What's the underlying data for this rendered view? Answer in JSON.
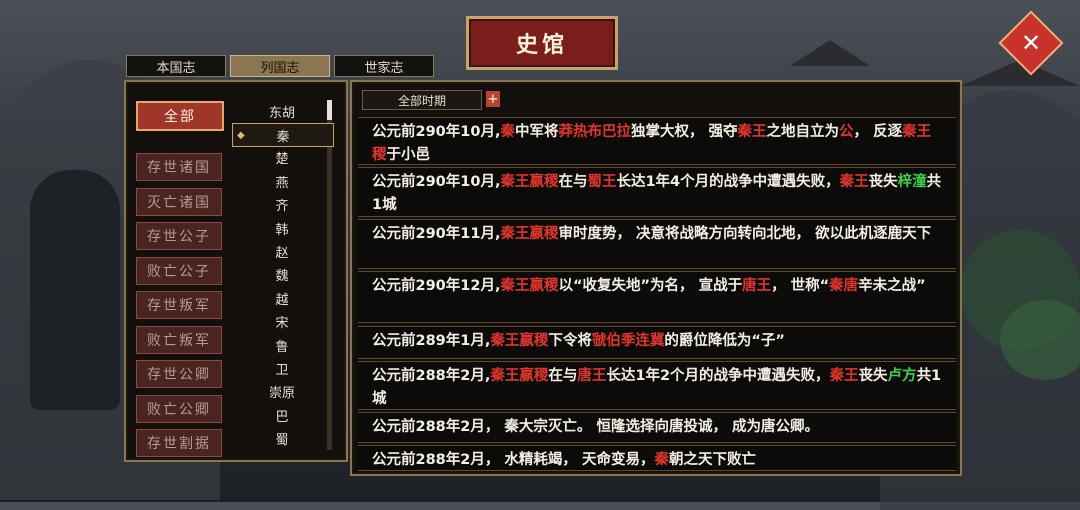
{
  "title": "史馆",
  "close_icon": "close-x-icon",
  "tabs": [
    {
      "label": "本国志",
      "active": false
    },
    {
      "label": "列国志",
      "active": true
    },
    {
      "label": "世家志",
      "active": false
    }
  ],
  "categories": [
    {
      "label": "全部",
      "active": true
    },
    {
      "label": "存世诸国",
      "active": false
    },
    {
      "label": "灭亡诸国",
      "active": false
    },
    {
      "label": "存世公子",
      "active": false
    },
    {
      "label": "败亡公子",
      "active": false
    },
    {
      "label": "存世叛军",
      "active": false
    },
    {
      "label": "败亡叛军",
      "active": false
    },
    {
      "label": "存世公卿",
      "active": false
    },
    {
      "label": "败亡公卿",
      "active": false
    },
    {
      "label": "存世割据",
      "active": false
    }
  ],
  "countries": [
    "东胡",
    "秦",
    "楚",
    "燕",
    "齐",
    "韩",
    "赵",
    "魏",
    "越",
    "宋",
    "鲁",
    "卫",
    "崇原",
    "巴",
    "蜀"
  ],
  "selected_country": "秦",
  "filter": {
    "label": "全部时期",
    "add_label": "+"
  },
  "events": [
    {
      "parts": [
        [
          "公元前290年10月,",
          ""
        ],
        [
          "秦",
          "red"
        ],
        [
          "中军将",
          ""
        ],
        [
          "莽热布巴拉",
          "red"
        ],
        [
          "独掌大权， 强夺",
          ""
        ],
        [
          "秦王",
          "red"
        ],
        [
          "之地自立为",
          ""
        ],
        [
          "公",
          "red"
        ],
        [
          "， 反逐",
          ""
        ],
        [
          "秦王稷",
          "red"
        ],
        [
          "于小邑",
          ""
        ]
      ]
    },
    {
      "parts": [
        [
          "公元前290年10月,",
          ""
        ],
        [
          "秦王嬴稷",
          "red"
        ],
        [
          "在与",
          ""
        ],
        [
          "蜀王",
          "red"
        ],
        [
          "长达1年4个月的战争中遭遇失败，",
          ""
        ],
        [
          "秦王",
          "red"
        ],
        [
          "丧失",
          ""
        ],
        [
          "梓潼",
          "green"
        ],
        [
          "共1城",
          ""
        ]
      ]
    },
    {
      "parts": [
        [
          "公元前290年11月,",
          ""
        ],
        [
          "秦王嬴稷",
          "red"
        ],
        [
          "审时度势， 决意将战略方向转向北地， 欲以此机逐鹿天下",
          ""
        ]
      ]
    },
    {
      "parts": [
        [
          "公元前290年12月,",
          ""
        ],
        [
          "秦王嬴稷",
          "red"
        ],
        [
          "以“收复失地”为名， 宣战于",
          ""
        ],
        [
          "唐王",
          "red"
        ],
        [
          "， 世称“",
          ""
        ],
        [
          "秦唐",
          "red"
        ],
        [
          "辛未之战”",
          ""
        ]
      ]
    },
    {
      "parts": [
        [
          "公元前289年1月,",
          ""
        ],
        [
          "秦王嬴稷",
          "red"
        ],
        [
          "下令将",
          ""
        ],
        [
          "虢伯季连冀",
          "red"
        ],
        [
          "的爵位降低为“子”",
          ""
        ]
      ]
    },
    {
      "parts": [
        [
          "公元前288年2月,",
          ""
        ],
        [
          "秦王嬴稷",
          "red"
        ],
        [
          "在与",
          ""
        ],
        [
          "唐王",
          "red"
        ],
        [
          "长达1年2个月的战争中遭遇失败，",
          ""
        ],
        [
          "秦王",
          "red"
        ],
        [
          "丧失",
          ""
        ],
        [
          "卢方",
          "green"
        ],
        [
          "共1城",
          ""
        ]
      ]
    },
    {
      "parts": [
        [
          "公元前288年2月， 秦大宗灭亡。 恒隆选择向唐投诚， 成为唐公卿。",
          ""
        ]
      ]
    },
    {
      "parts": [
        [
          "公元前288年2月， 水精耗竭， 天命变易，",
          ""
        ],
        [
          "秦",
          "red"
        ],
        [
          "朝之天下败亡",
          ""
        ]
      ]
    }
  ]
}
